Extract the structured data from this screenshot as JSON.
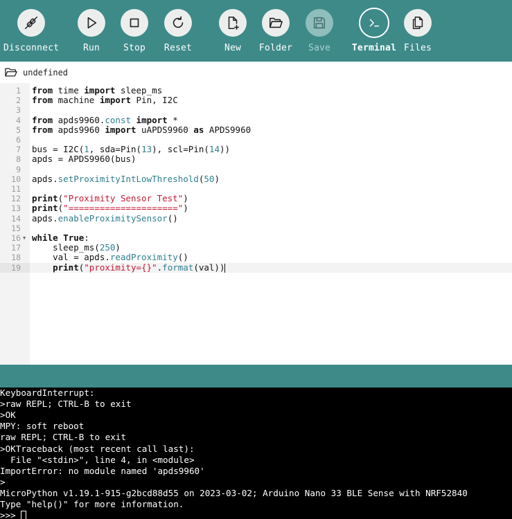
{
  "toolbar": {
    "buttons": [
      {
        "id": "disconnect",
        "label": "Disconnect",
        "icon": "plug-disconnect-icon",
        "state": "normal"
      },
      {
        "id": "run",
        "label": "Run",
        "icon": "play-icon",
        "state": "normal"
      },
      {
        "id": "stop",
        "label": "Stop",
        "icon": "stop-icon",
        "state": "normal"
      },
      {
        "id": "reset",
        "label": "Reset",
        "icon": "reset-icon",
        "state": "normal"
      },
      {
        "id": "new",
        "label": "New",
        "icon": "new-file-icon",
        "state": "normal"
      },
      {
        "id": "folder",
        "label": "Folder",
        "icon": "folder-open-icon",
        "state": "normal"
      },
      {
        "id": "save",
        "label": "Save",
        "icon": "save-icon",
        "state": "disabled"
      },
      {
        "id": "terminal",
        "label": "Terminal",
        "icon": "terminal-icon",
        "state": "active"
      },
      {
        "id": "files",
        "label": "Files",
        "icon": "files-icon",
        "state": "normal"
      }
    ],
    "accent_color": "#3d8a89"
  },
  "filebar": {
    "icon": "folder-icon",
    "filename": "undefined"
  },
  "editor": {
    "current_line": 19,
    "lines": [
      {
        "n": "1",
        "tokens": [
          [
            "kw",
            "from"
          ],
          [
            "p",
            " time "
          ],
          [
            "kw",
            "import"
          ],
          [
            "p",
            " sleep_ms"
          ]
        ]
      },
      {
        "n": "2",
        "tokens": [
          [
            "kw",
            "from"
          ],
          [
            "p",
            " machine "
          ],
          [
            "kw",
            "import"
          ],
          [
            "p",
            " Pin, I2C"
          ]
        ]
      },
      {
        "n": "3",
        "tokens": []
      },
      {
        "n": "4",
        "tokens": [
          [
            "kw",
            "from"
          ],
          [
            "p",
            " apds9960."
          ],
          [
            "fn",
            "const"
          ],
          [
            "p",
            " "
          ],
          [
            "kw",
            "import"
          ],
          [
            "p",
            " *"
          ]
        ]
      },
      {
        "n": "5",
        "tokens": [
          [
            "kw",
            "from"
          ],
          [
            "p",
            " apds9960 "
          ],
          [
            "kw",
            "import"
          ],
          [
            "p",
            " uAPDS9960 "
          ],
          [
            "kw",
            "as"
          ],
          [
            "p",
            " APDS9960"
          ]
        ]
      },
      {
        "n": "6",
        "tokens": []
      },
      {
        "n": "7",
        "tokens": [
          [
            "p",
            "bus = I2C("
          ],
          [
            "numlit",
            "1"
          ],
          [
            "p",
            ", sda=Pin("
          ],
          [
            "numlit",
            "13"
          ],
          [
            "p",
            "), scl=Pin("
          ],
          [
            "numlit",
            "14"
          ],
          [
            "p",
            "))"
          ]
        ]
      },
      {
        "n": "8",
        "tokens": [
          [
            "p",
            "apds = APDS9960(bus)"
          ]
        ]
      },
      {
        "n": "9",
        "tokens": []
      },
      {
        "n": "10",
        "tokens": [
          [
            "p",
            "apds."
          ],
          [
            "fn",
            "setProximityIntLowThreshold"
          ],
          [
            "p",
            "("
          ],
          [
            "numlit",
            "50"
          ],
          [
            "p",
            ")"
          ]
        ]
      },
      {
        "n": "11",
        "tokens": []
      },
      {
        "n": "12",
        "tokens": [
          [
            "kw",
            "print"
          ],
          [
            "p",
            "("
          ],
          [
            "str",
            "\"Proximity Sensor Test\""
          ],
          [
            "p",
            ")"
          ]
        ]
      },
      {
        "n": "13",
        "tokens": [
          [
            "kw",
            "print"
          ],
          [
            "p",
            "("
          ],
          [
            "str",
            "\"=====================\""
          ],
          [
            "p",
            ")"
          ]
        ]
      },
      {
        "n": "14",
        "tokens": [
          [
            "p",
            "apds."
          ],
          [
            "fn",
            "enableProximitySensor"
          ],
          [
            "p",
            "()"
          ]
        ]
      },
      {
        "n": "15",
        "tokens": []
      },
      {
        "n": "16",
        "fold": true,
        "tokens": [
          [
            "kw",
            "while"
          ],
          [
            "p",
            " "
          ],
          [
            "kw",
            "True"
          ],
          [
            "p",
            ":"
          ]
        ]
      },
      {
        "n": "17",
        "tokens": [
          [
            "p",
            "    sleep_ms("
          ],
          [
            "numlit",
            "250"
          ],
          [
            "p",
            ")"
          ]
        ]
      },
      {
        "n": "18",
        "tokens": [
          [
            "p",
            "    val = apds."
          ],
          [
            "fn",
            "readProximity"
          ],
          [
            "p",
            "()"
          ]
        ]
      },
      {
        "n": "19",
        "tokens": [
          [
            "p",
            "    "
          ],
          [
            "kw",
            "print"
          ],
          [
            "p",
            "("
          ],
          [
            "str",
            "\"proximity={}\""
          ],
          [
            "p",
            "."
          ],
          [
            "fn",
            "format"
          ],
          [
            "p",
            "(val))"
          ]
        ]
      }
    ]
  },
  "terminal": {
    "lines": [
      "KeyboardInterrupt:",
      ">raw REPL; CTRL-B to exit",
      ">OK",
      "MPY: soft reboot",
      "raw REPL; CTRL-B to exit",
      ">OKTraceback (most recent call last):",
      "  File \"<stdin>\", line 4, in <module>",
      "ImportError: no module named 'apds9960'",
      ">",
      "MicroPython v1.19.1-915-g2bcd88d55 on 2023-03-02; Arduino Nano 33 BLE Sense with NRF52840",
      "Type \"help()\" for more information.",
      ">>> "
    ]
  }
}
